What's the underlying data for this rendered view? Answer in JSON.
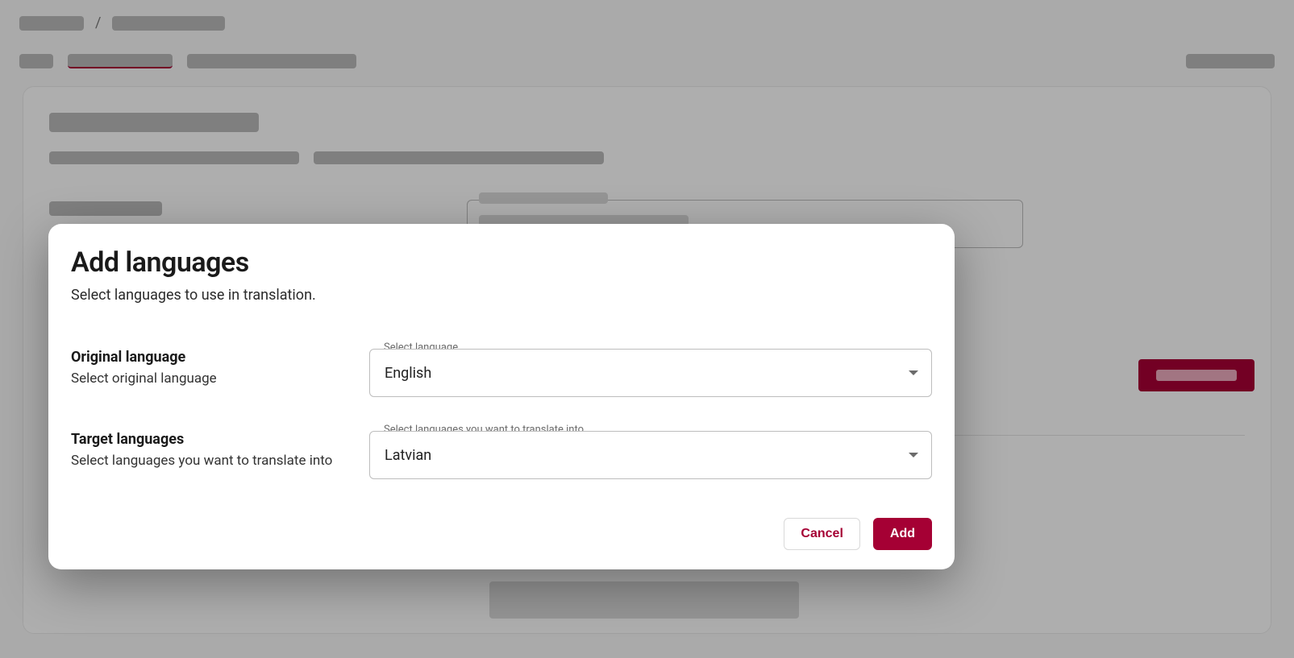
{
  "colors": {
    "accent": "#a50034"
  },
  "breadcrumb": {
    "separator": "/"
  },
  "modal": {
    "title": "Add languages",
    "subtitle": "Select languages to use in translation.",
    "original": {
      "label": "Original language",
      "hint": "Select original language",
      "select_label": "Select language",
      "value": "English"
    },
    "target": {
      "label": "Target languages",
      "hint": "Select languages you want to translate into",
      "select_label": "Select languages you want to translate into",
      "value": "Latvian"
    },
    "actions": {
      "cancel": "Cancel",
      "add": "Add"
    }
  }
}
